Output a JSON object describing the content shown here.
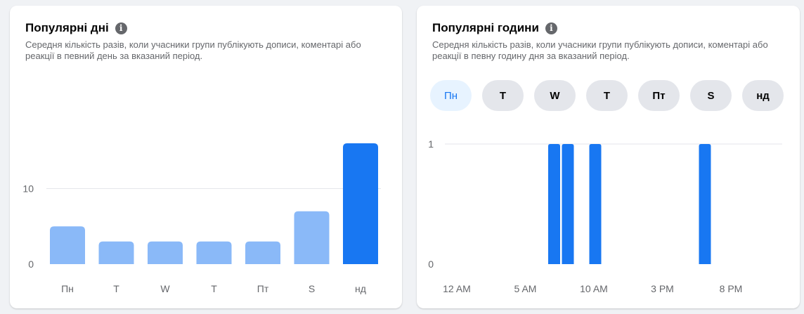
{
  "card1": {
    "title": "Популярні дні",
    "description": "Середня кількість разів, коли учасники групи публікують дописи, коментарі або реакції в певний день за вказаний період."
  },
  "card2": {
    "title": "Популярні години",
    "description": "Середня кількість разів, коли учасники групи публікують дописи, коментарі або реакції в певну годину дня за вказаний період.",
    "day_tabs": [
      {
        "label": "Пн",
        "selected": true
      },
      {
        "label": "T",
        "selected": false
      },
      {
        "label": "W",
        "selected": false
      },
      {
        "label": "T",
        "selected": false
      },
      {
        "label": "Пт",
        "selected": false
      },
      {
        "label": "S",
        "selected": false
      },
      {
        "label": "нд",
        "selected": false
      }
    ]
  },
  "colors": {
    "bar_light": "#8ab9f8",
    "bar_dark": "#1877f2",
    "active_tab_bg": "#e7f3ff",
    "active_tab_text": "#1877f2",
    "tab_bg": "#e4e6eb",
    "grid": "#e4e6eb"
  },
  "chart_data": [
    {
      "type": "bar",
      "categories": [
        "Пн",
        "T",
        "W",
        "T",
        "Пт",
        "S",
        "нд"
      ],
      "values": [
        5,
        3,
        3,
        3,
        3,
        7,
        16
      ],
      "highlight_index": 6,
      "yticks": [
        0,
        10
      ],
      "ytick_labels": [
        "0",
        "10"
      ],
      "ylim": [
        0,
        16
      ],
      "grid": true
    },
    {
      "type": "bar",
      "x": [
        0,
        1,
        2,
        3,
        4,
        5,
        6,
        7,
        8,
        9,
        10,
        11,
        12,
        13,
        14,
        15,
        16,
        17,
        18,
        19,
        20,
        21,
        22,
        23
      ],
      "values": [
        0,
        0,
        0,
        0,
        0,
        0,
        0,
        1,
        1,
        0,
        1,
        0,
        0,
        0,
        0,
        0,
        0,
        0,
        1,
        0,
        0,
        0,
        0,
        0
      ],
      "xticks": [
        0,
        5,
        10,
        15,
        20
      ],
      "xtick_labels": [
        "12 AM",
        "5 AM",
        "10 AM",
        "3 PM",
        "8 PM"
      ],
      "yticks": [
        0,
        1
      ],
      "ytick_labels": [
        "0",
        "1"
      ],
      "ylim": [
        0,
        1
      ],
      "grid": true
    }
  ]
}
